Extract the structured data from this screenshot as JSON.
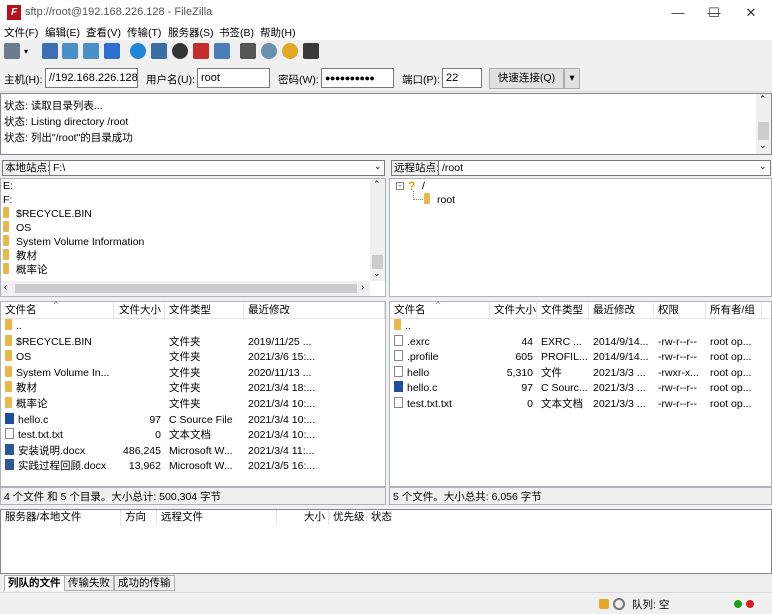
{
  "window": {
    "title": "sftp://root@192.168.226.128 - FileZilla",
    "app_icon": "F",
    "controls": [
      "—",
      "☐",
      "✕"
    ]
  },
  "menu": [
    "文件(F)",
    "编辑(E)",
    "查看(V)",
    "传输(T)",
    "服务器(S)",
    "书签(B)",
    "帮助(H)"
  ],
  "quickconnect": {
    "host_label": "主机(H):",
    "host_value": "//192.168.226.128",
    "user_label": "用户名(U):",
    "user_value": "root",
    "pass_label": "密码(W):",
    "pass_value": "●●●●●●●●●●",
    "port_label": "端口(P):",
    "port_value": "22",
    "connect_label": "快速连接(Q)",
    "dropdown": "▾"
  },
  "log": [
    {
      "prefix": "状态:",
      "text": "读取目录列表..."
    },
    {
      "prefix": "状态:",
      "text": "Listing directory /root"
    },
    {
      "prefix": "状态:",
      "text": "列出\"/root\"的目录成功"
    }
  ],
  "local": {
    "site_label": "本地站点:",
    "site_path": "F:\\",
    "tree": [
      "E:",
      "F:",
      "$RECYCLE.BIN",
      "OS",
      "System Volume Information",
      "教材",
      "概率论"
    ],
    "headers": [
      "文件名",
      "文件大小",
      "文件类型",
      "最近修改"
    ],
    "rows": [
      {
        "name": "..",
        "size": "",
        "type": "",
        "mod": "",
        "icon": "folder"
      },
      {
        "name": "$RECYCLE.BIN",
        "size": "",
        "type": "文件夹",
        "mod": "2019/11/25 ...",
        "icon": "folder"
      },
      {
        "name": "OS",
        "size": "",
        "type": "文件夹",
        "mod": "2021/3/6 15:...",
        "icon": "folder"
      },
      {
        "name": "System Volume In...",
        "size": "",
        "type": "文件夹",
        "mod": "2020/11/13 ...",
        "icon": "folder"
      },
      {
        "name": "教材",
        "size": "",
        "type": "文件夹",
        "mod": "2021/3/4 18:...",
        "icon": "folder"
      },
      {
        "name": "概率论",
        "size": "",
        "type": "文件夹",
        "mod": "2021/3/4 10:...",
        "icon": "folder"
      },
      {
        "name": "hello.c",
        "size": "97",
        "type": "C Source File",
        "mod": "2021/3/4 10:...",
        "icon": "cfile"
      },
      {
        "name": "test.txt.txt",
        "size": "0",
        "type": "文本文档",
        "mod": "2021/3/4 10:...",
        "icon": "file"
      },
      {
        "name": "安装说明.docx",
        "size": "486,245",
        "type": "Microsoft W...",
        "mod": "2021/3/4 11:...",
        "icon": "docx"
      },
      {
        "name": "实践过程回顾.docx",
        "size": "13,962",
        "type": "Microsoft W...",
        "mod": "2021/3/5 16:...",
        "icon": "docx"
      }
    ],
    "status": "4 个文件 和 5 个目录。大小总计: 500,304 字节"
  },
  "remote": {
    "site_label": "远程站点:",
    "site_path": "/root",
    "tree_root": "/",
    "tree_child": "root",
    "tree_root_icon": "?",
    "headers": [
      "文件名",
      "文件大小",
      "文件类型",
      "最近修改",
      "权限",
      "所有者/组"
    ],
    "rows": [
      {
        "name": "..",
        "size": "",
        "type": "",
        "mod": "",
        "perm": "",
        "owner": "",
        "icon": "folder"
      },
      {
        "name": ".exrc",
        "size": "44",
        "type": "EXRC ...",
        "mod": "2014/9/14...",
        "perm": "-rw-r--r--",
        "owner": "root op...",
        "icon": "file"
      },
      {
        "name": ".profile",
        "size": "605",
        "type": "PROFIL...",
        "mod": "2014/9/14...",
        "perm": "-rw-r--r--",
        "owner": "root op...",
        "icon": "file"
      },
      {
        "name": "hello",
        "size": "5,310",
        "type": "文件",
        "mod": "2021/3/3 ...",
        "perm": "-rwxr-x...",
        "owner": "root op...",
        "icon": "file"
      },
      {
        "name": "hello.c",
        "size": "97",
        "type": "C Sourc...",
        "mod": "2021/3/3 ...",
        "perm": "-rw-r--r--",
        "owner": "root op...",
        "icon": "cfile"
      },
      {
        "name": "test.txt.txt",
        "size": "0",
        "type": "文本文档",
        "mod": "2021/3/3 ...",
        "perm": "-rw-r--r--",
        "owner": "root op...",
        "icon": "file"
      }
    ],
    "status": "5 个文件。大小总共: 6,056 字节"
  },
  "queue": {
    "headers": [
      "服务器/本地文件",
      "方向",
      "远程文件",
      "大小",
      "优先级",
      "状态"
    ]
  },
  "tabs": [
    "列队的文件",
    "传输失败",
    "成功的传输"
  ],
  "statusbar": {
    "queue_text": "队列: 空",
    "green": "#1ca01c",
    "red": "#d62020"
  }
}
